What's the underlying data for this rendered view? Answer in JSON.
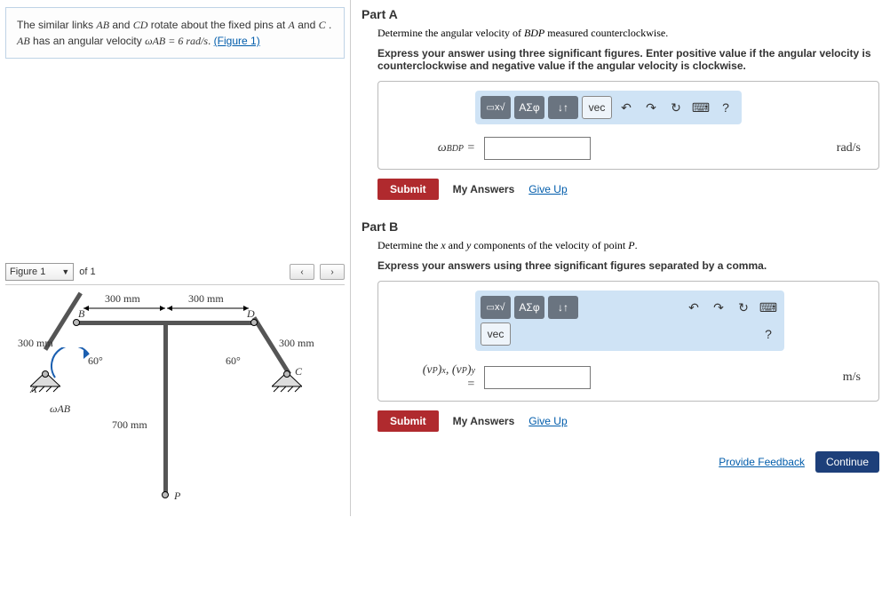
{
  "problem": {
    "text1": "The similar links ",
    "AB": "AB",
    "text2": " and ",
    "CD": "CD",
    "text3": " rotate about the fixed pins at ",
    "A": "A",
    "text4": " and ",
    "C": "C",
    "text5": ". ",
    "text6": " has an angular velocity ",
    "omega": "ωAB = 6 rad/s",
    "figlink": "(Figure 1)"
  },
  "figbar": {
    "selected": "Figure 1",
    "of": "of 1"
  },
  "figure": {
    "d300a": "300 mm",
    "d300b": "300 mm",
    "d300c": "300 mm",
    "d300d": "300 mm",
    "ang1": "60°",
    "ang2": "60°",
    "d700": "700 mm",
    "B": "B",
    "D": "D",
    "A": "A",
    "C": "C",
    "P": "P",
    "wab": "ωAB"
  },
  "partA": {
    "title": "Part A",
    "instr": "Determine the angular velocity of BDP measured counterclockwise.",
    "bold": "Express your answer using three significant figures. Enter positive value if the angular velocity is counterclockwise and negative value if the angular velocity is clockwise.",
    "eq_label": "ωBDP =",
    "unit": "rad/s",
    "input": ""
  },
  "partB": {
    "title": "Part B",
    "instr": "Determine the x and y components of the velocity of point P.",
    "bold": "Express your answers using three significant figures separated by a comma.",
    "eq_label": "(vP)x, (vP)y =",
    "unit": "m/s",
    "input": ""
  },
  "toolbar": {
    "tmpl": "x√",
    "greek": "ΑΣφ",
    "updown": "↓↑",
    "vec": "vec",
    "undo": "↶",
    "redo": "↷",
    "reset": "↻",
    "kbd": "⌨",
    "help": "?"
  },
  "buttons": {
    "submit": "Submit",
    "myans": "My Answers",
    "giveup": "Give Up",
    "feedback": "Provide Feedback",
    "continue": "Continue"
  }
}
